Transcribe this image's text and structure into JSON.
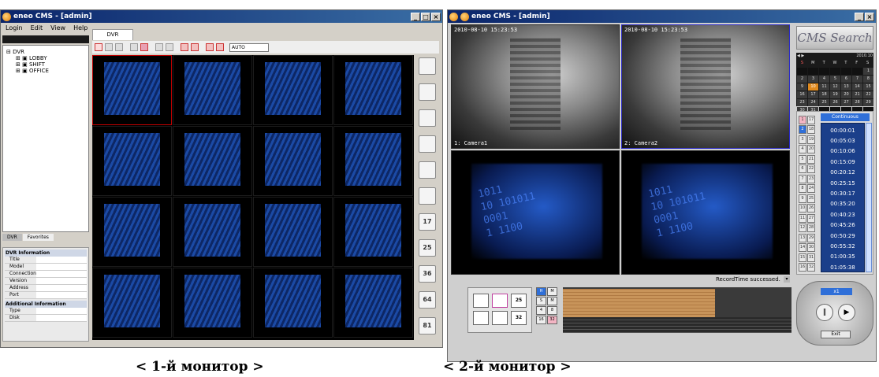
{
  "monitor1": {
    "title": "eneo CMS - [admin]",
    "menu": [
      "Login",
      "Edit",
      "View",
      "Help"
    ],
    "tab_label": "DVR",
    "zoom_value": "AUTO",
    "tree": {
      "root": "DVR",
      "items": [
        "LOBBY",
        "SHIFT",
        "OFFICE"
      ]
    },
    "bottom_tabs": [
      "DVR",
      "Favorites"
    ],
    "info_panel": {
      "header": "DVR Information",
      "rows": [
        "Title",
        "Model",
        "Connection",
        "Version",
        "Address",
        "Port"
      ],
      "section2": "Additional Information",
      "rows2": [
        "Type",
        "Disk"
      ]
    },
    "side_buttons": [
      "",
      "",
      "",
      "",
      "",
      "",
      "17",
      "25",
      "36",
      "64",
      "81"
    ]
  },
  "monitor2": {
    "title": "eneo CMS - [admin]",
    "cam_timestamps": [
      "2010-08-10 15:23:53",
      "2010-08-10 15:23:53"
    ],
    "cam_labels": [
      "1: Camera1",
      "2: Camera2"
    ],
    "binary_text": "1011\n10 101011\n0001\n1 1100",
    "search_label": "CMS Search",
    "calendar": {
      "month": "2010.10",
      "weekdays": [
        "S",
        "M",
        "T",
        "W",
        "T",
        "F",
        "S"
      ],
      "days": [
        "",
        "",
        "",
        "",
        "",
        "",
        "1",
        "2",
        "3",
        "4",
        "5",
        "6",
        "7",
        "8",
        "9",
        "10",
        "11",
        "12",
        "13",
        "14",
        "15",
        "16",
        "17",
        "18",
        "19",
        "20",
        "21",
        "22",
        "23",
        "24",
        "25",
        "26",
        "27",
        "28",
        "29",
        "30",
        "31",
        "",
        "",
        "",
        "",
        ""
      ]
    },
    "search_mode": "Continuous",
    "channel_numbers": [
      "1",
      "2",
      "3",
      "4",
      "5",
      "6",
      "7",
      "8",
      "9",
      "10",
      "11",
      "12",
      "13",
      "14",
      "15",
      "16"
    ],
    "channel_numbers2": [
      "17",
      "18",
      "19",
      "20",
      "21",
      "22",
      "23",
      "24",
      "25",
      "26",
      "27",
      "28",
      "29",
      "30",
      "31",
      "32"
    ],
    "times": [
      "00:00:01",
      "00:05:03",
      "00:10:06",
      "00:15:09",
      "00:20:12",
      "00:25:15",
      "00:30:17",
      "00:35:20",
      "00:40:23",
      "00:45:26",
      "00:50:29",
      "00:55:32",
      "01:00:35",
      "01:05:38"
    ],
    "status_text": "RecordTime successed.",
    "layout_buttons": [
      "",
      "",
      "25",
      "",
      "",
      "32"
    ],
    "hour_buttons": [
      "H",
      "M",
      "S",
      "M",
      "4",
      "8",
      "16",
      "32"
    ],
    "speed_value": "x1",
    "exit_label": "Exit"
  },
  "captions": [
    "< 1-й монитор >",
    "< 2-й монитор >"
  ],
  "colors": {
    "title_bar": "#0a246a",
    "video_blue": "#1d4fae",
    "timeline": "#c8945a",
    "selected_tile": "#c00000"
  }
}
